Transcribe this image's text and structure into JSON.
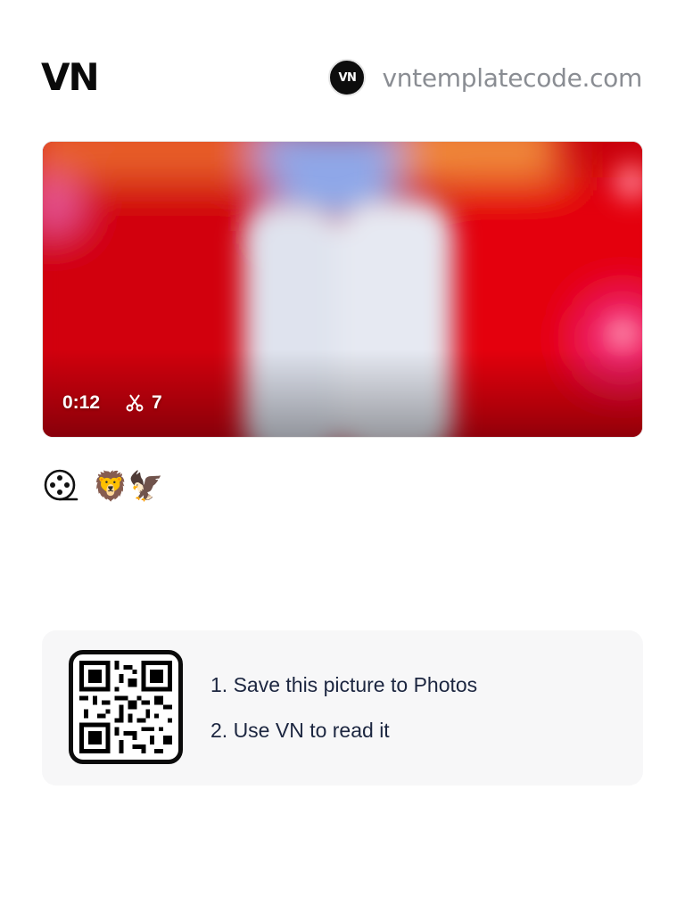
{
  "header": {
    "logo": "VN",
    "site_badge": "VN",
    "site_url": "vntemplatecode.com"
  },
  "video": {
    "duration": "0:12",
    "cut_count": "7",
    "cut_icon": "scissors-icon"
  },
  "meta": {
    "reel_icon": "film-reel-icon",
    "emojis": "🦁🦅"
  },
  "qr": {
    "icon": "qr-code-icon",
    "steps": [
      "1. Save this picture to Photos",
      "2. Use VN to read it"
    ]
  }
}
